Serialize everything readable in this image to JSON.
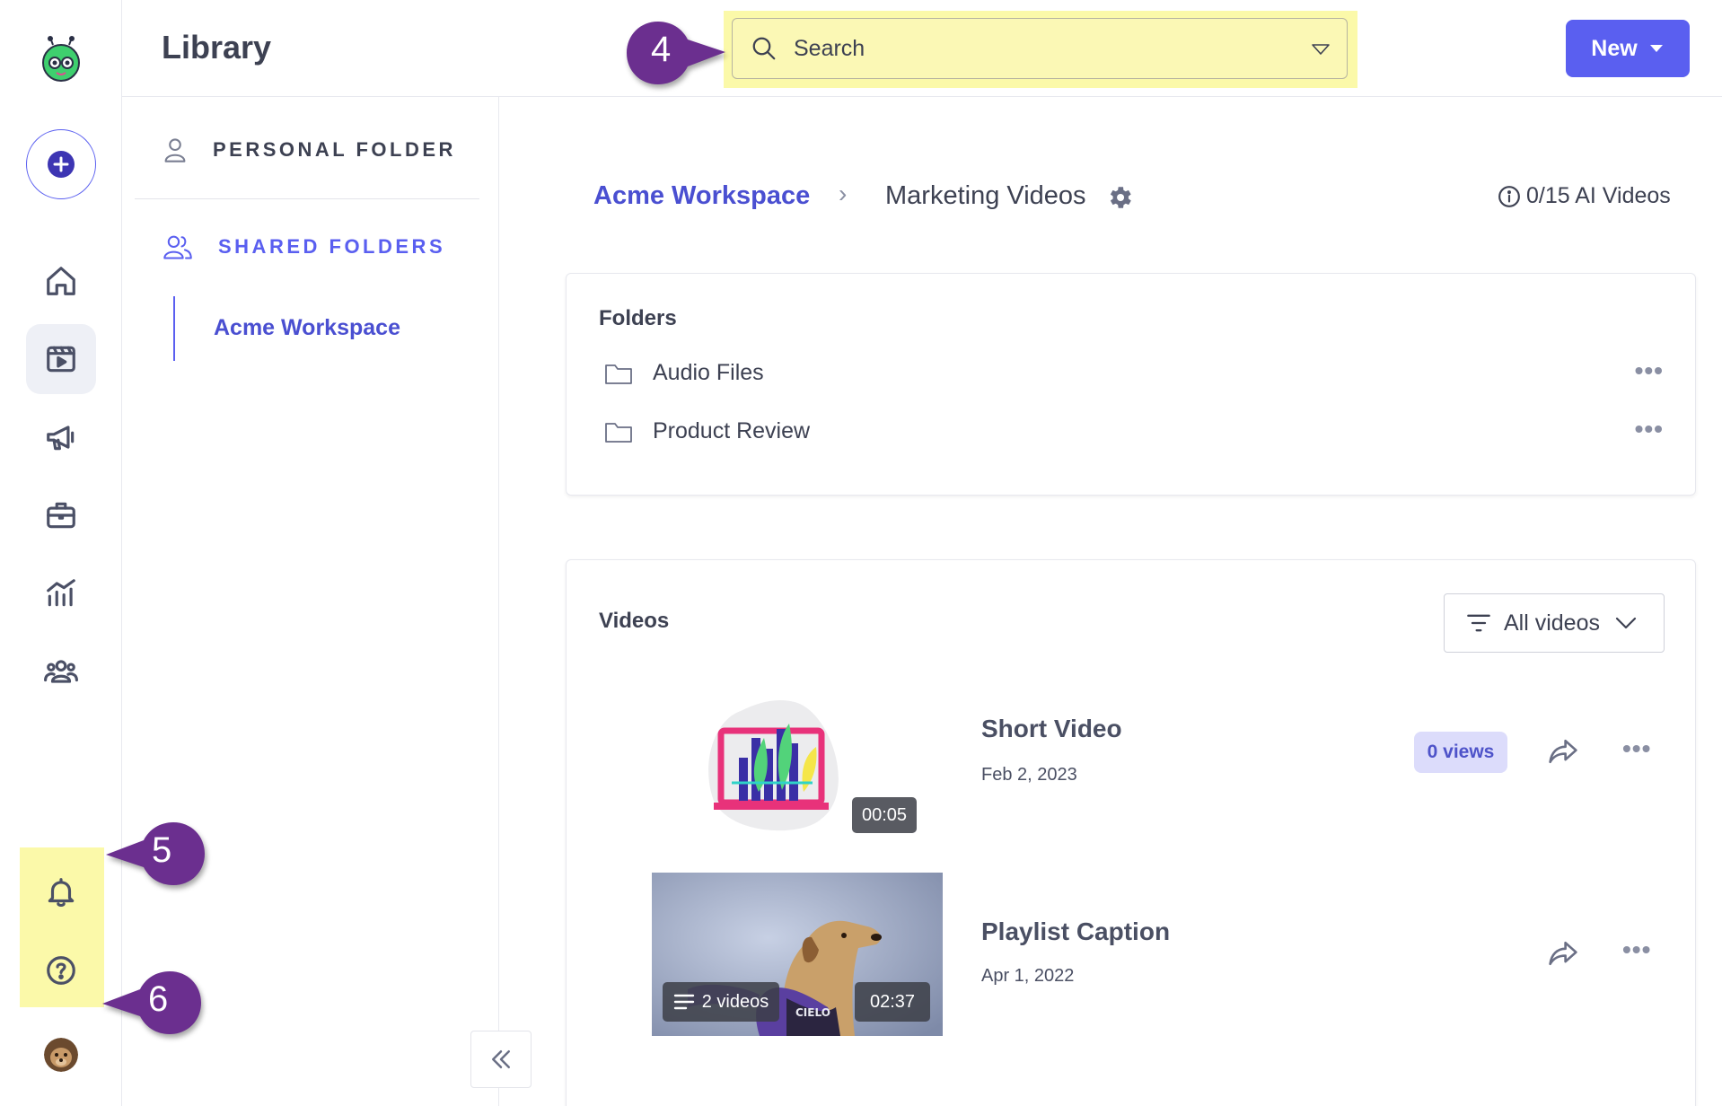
{
  "header": {
    "title": "Library",
    "search_placeholder": "Search",
    "new_button": "New"
  },
  "sidebar": {
    "personal_folder": "PERSONAL FOLDER",
    "shared_folders": "SHARED FOLDERS",
    "workspace_item": "Acme Workspace"
  },
  "breadcrumb": {
    "workspace": "Acme Workspace",
    "separator": "›",
    "current": "Marketing Videos",
    "ai_videos": "0/15 AI Videos"
  },
  "folders": {
    "title": "Folders",
    "items": [
      {
        "name": "Audio Files"
      },
      {
        "name": "Product Review"
      }
    ],
    "more": "•••"
  },
  "videos": {
    "title": "Videos",
    "filter": "All videos",
    "items": [
      {
        "title": "Short Video",
        "date": "Feb 2, 2023",
        "duration": "00:05",
        "views": "0 views"
      },
      {
        "title": "Playlist Caption",
        "date": "Apr 1, 2022",
        "duration": "02:37",
        "playlist_count": "2 videos"
      }
    ],
    "more": "•••"
  },
  "callouts": {
    "search": "4",
    "notifications": "5",
    "help": "6"
  },
  "colors": {
    "accent": "#5a5ff0",
    "link": "#4a4fd1",
    "highlight": "#fbf9a9",
    "callout": "#6b2f8f"
  }
}
